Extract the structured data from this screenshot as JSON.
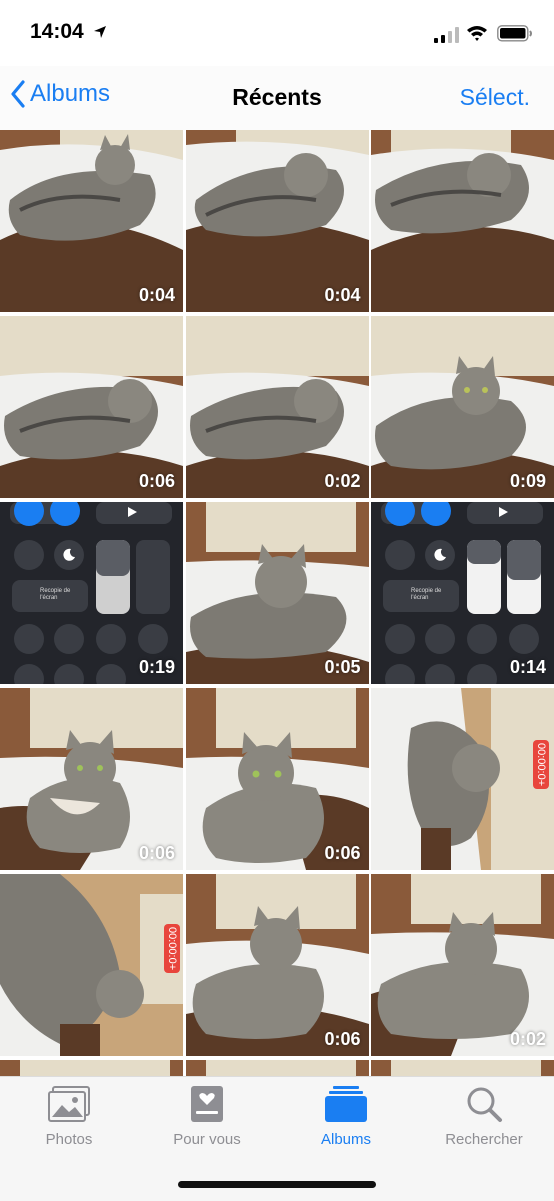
{
  "status_bar": {
    "time": "14:04",
    "icons": [
      "location-arrow-icon",
      "cellular-signal-icon",
      "wifi-icon",
      "battery-icon"
    ]
  },
  "nav": {
    "back_label": "Albums",
    "title": "Récents",
    "select_label": "Sélect."
  },
  "grid": [
    {
      "type": "video",
      "duration": "0:04"
    },
    {
      "type": "video",
      "duration": "0:04"
    },
    {
      "type": "video",
      "duration": ""
    },
    {
      "type": "video",
      "duration": "0:06"
    },
    {
      "type": "video",
      "duration": "0:02"
    },
    {
      "type": "video",
      "duration": "0:09"
    },
    {
      "type": "screen-recording",
      "duration": "0:19"
    },
    {
      "type": "video",
      "duration": "0:05"
    },
    {
      "type": "screen-recording",
      "duration": "0:14"
    },
    {
      "type": "video",
      "duration": "0:06"
    },
    {
      "type": "video",
      "duration": "0:06"
    },
    {
      "type": "photo",
      "duration": ""
    },
    {
      "type": "photo",
      "duration": ""
    },
    {
      "type": "video",
      "duration": "0:06"
    },
    {
      "type": "video",
      "duration": "0:02"
    },
    {
      "type": "photo",
      "duration": ""
    },
    {
      "type": "photo",
      "duration": ""
    },
    {
      "type": "photo",
      "duration": ""
    }
  ],
  "control_center": {
    "screen_mirroring_label": "Recopie de l'écran"
  },
  "recording_badge": "00:00:0+",
  "tabs": [
    {
      "label": "Photos",
      "icon": "photos-icon",
      "active": false
    },
    {
      "label": "Pour vous",
      "icon": "for-you-icon",
      "active": false
    },
    {
      "label": "Albums",
      "icon": "albums-icon",
      "active": true
    },
    {
      "label": "Rechercher",
      "icon": "search-icon",
      "active": false
    }
  ],
  "colors": {
    "accent": "#1a7ef2",
    "inactive_tab": "#8e8e93"
  }
}
